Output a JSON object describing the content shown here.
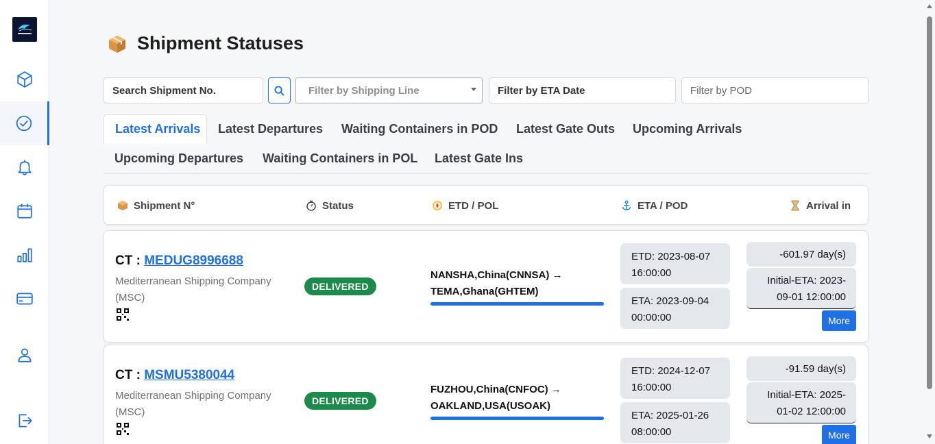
{
  "header": {
    "title": "Shipment Statuses"
  },
  "sidebar": {
    "items": [
      {
        "name": "shipments",
        "icon": "cube-icon"
      },
      {
        "name": "statuses",
        "icon": "check-circle-icon",
        "active": true
      },
      {
        "name": "notifications",
        "icon": "bell-icon"
      },
      {
        "name": "calendar",
        "icon": "calendar-icon"
      },
      {
        "name": "reports",
        "icon": "bar-chart-icon"
      },
      {
        "name": "billing",
        "icon": "credit-card-icon"
      },
      {
        "name": "profile",
        "icon": "user-icon"
      },
      {
        "name": "logout",
        "icon": "logout-icon"
      }
    ]
  },
  "filters": {
    "search_placeholder": "Search Shipment No.",
    "shipping_line_placeholder": "Filter by Shipping Line",
    "eta_date_placeholder": "Filter by ETA Date",
    "pod_placeholder": "Filter by POD"
  },
  "tabs": [
    {
      "label": "Latest Arrivals",
      "active": true
    },
    {
      "label": "Latest Departures"
    },
    {
      "label": "Waiting Containers in POD"
    },
    {
      "label": "Latest Gate Outs"
    },
    {
      "label": "Upcoming Arrivals"
    },
    {
      "label": "Upcoming Departures"
    },
    {
      "label": "Waiting Containers in POL"
    },
    {
      "label": "Latest Gate Ins"
    }
  ],
  "table": {
    "columns": [
      "Shipment N°",
      "Status",
      "ETD / POL",
      "ETA / POD",
      "Arrival in"
    ],
    "rows": [
      {
        "prefix": "CT : ",
        "number": "MEDUG8996688",
        "carrier": "Mediterranean Shipping Company (MSC)",
        "status": "DELIVERED",
        "route": "NANSHA,China(CNNSA) → TEMA,Ghana(GHTEM)",
        "etd": "ETD: 2023-08-07 16:00:00",
        "eta": "ETA: 2023-09-04 00:00:00",
        "arrival_days": "-601.97 day(s)",
        "initial_eta": "Initial-ETA: 2023-09-01 12:00:00",
        "more_label": "More"
      },
      {
        "prefix": "CT : ",
        "number": "MSMU5380044",
        "carrier": "Mediterranean Shipping Company (MSC)",
        "status": "DELIVERED",
        "route": "FUZHOU,China(CNFOC) → OAKLAND,USA(USOAK)",
        "etd": "ETD: 2024-12-07 16:00:00",
        "eta": "ETA: 2025-01-26 08:00:00",
        "arrival_days": "-91.59 day(s)",
        "initial_eta": "Initial-ETA: 2025-01-02 12:00:00",
        "more_label": "More"
      }
    ]
  },
  "colors": {
    "accent": "#1f6fe5",
    "delivered": "#1c8a4a"
  }
}
